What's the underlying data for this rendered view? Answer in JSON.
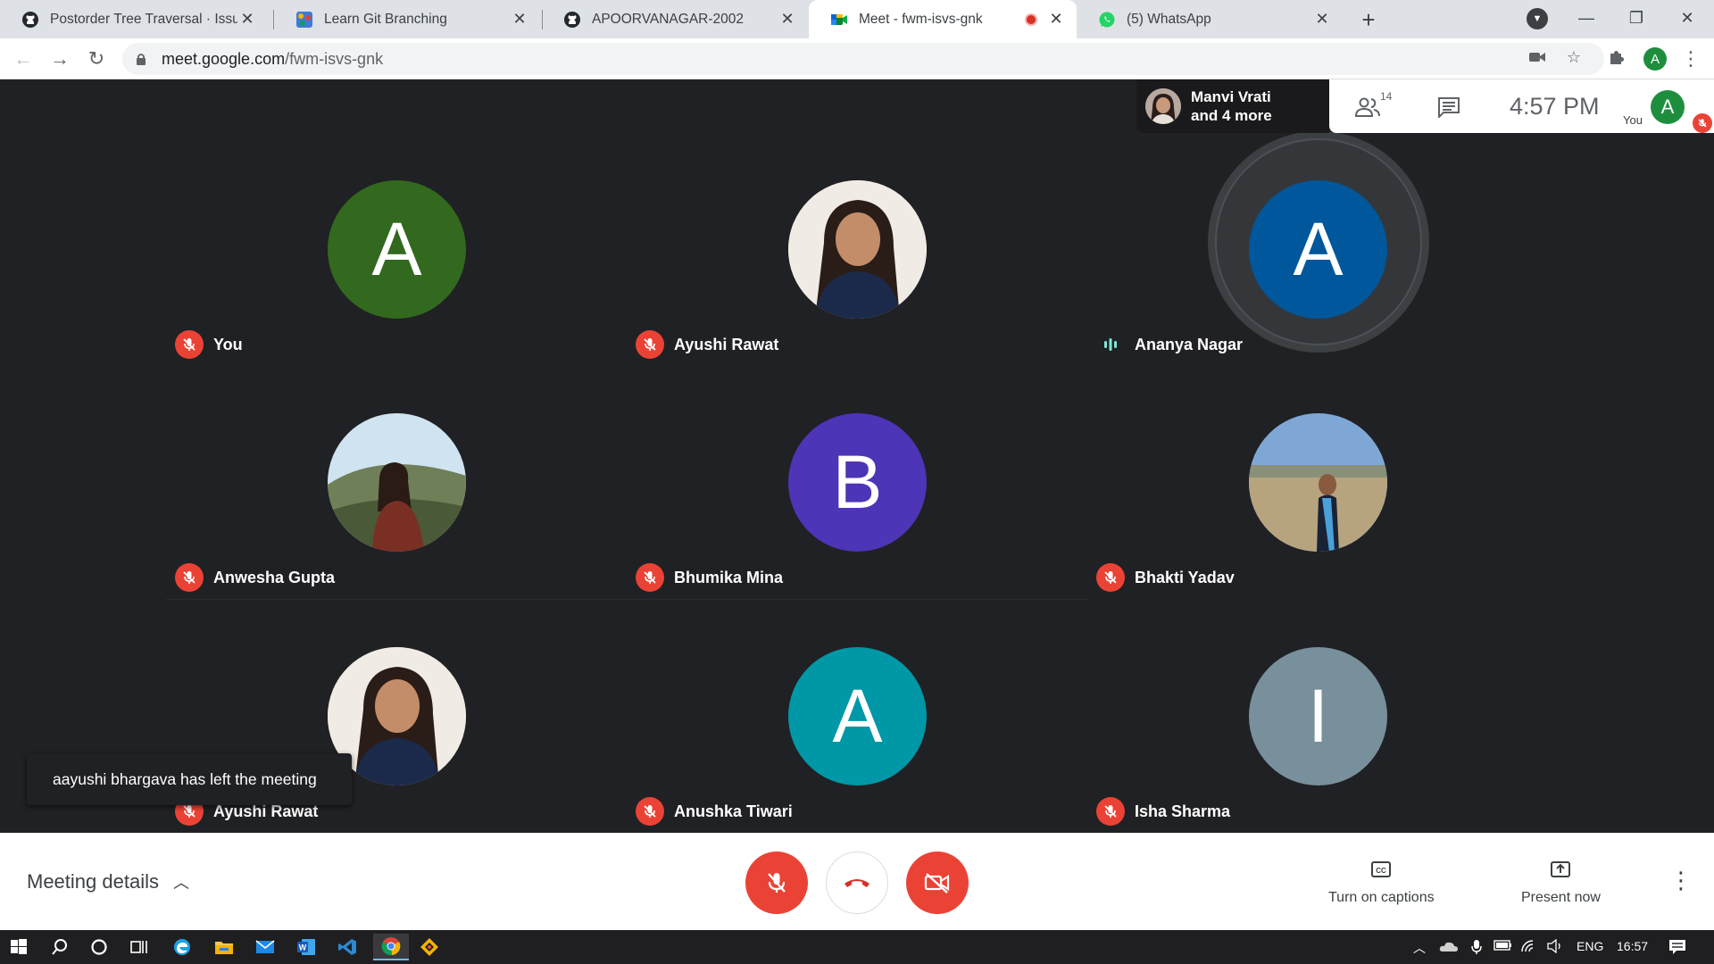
{
  "browser": {
    "tabs": [
      {
        "title": "Postorder Tree Traversal · Issue #",
        "icon": "github-icon",
        "active": false
      },
      {
        "title": "Learn Git Branching",
        "icon": "git-branching-icon",
        "active": false
      },
      {
        "title": "APOORVANAGAR-2002",
        "icon": "github-icon",
        "active": false
      },
      {
        "title": "Meet - fwm-isvs-gnk",
        "icon": "meet-icon",
        "active": true
      },
      {
        "title": "(5) WhatsApp",
        "icon": "whatsapp-icon",
        "active": false
      }
    ],
    "url_domain": "meet.google.com",
    "url_path": "/fwm-isvs-gnk",
    "profile_initial": "A"
  },
  "meet": {
    "presenter_line1": "Manvi Vrati",
    "presenter_line2": "and 4 more",
    "people_count": "14",
    "clock": "4:57  PM",
    "self_label": "You",
    "self_initial": "A",
    "participants": [
      {
        "name": "You",
        "initial": "A",
        "color": "#33691e",
        "mic": "muted"
      },
      {
        "name": "Ayushi Rawat",
        "initial": "",
        "color": "#1b2a4a",
        "mic": "muted"
      },
      {
        "name": "Ananya Nagar",
        "initial": "A",
        "color": "#01579b",
        "mic": "speaking"
      },
      {
        "name": "Anwesha Gupta",
        "initial": "",
        "color": "#7a8c6a",
        "mic": "muted"
      },
      {
        "name": "Bhumika Mina",
        "initial": "B",
        "color": "#4e34b6",
        "mic": "muted"
      },
      {
        "name": "Bhakti Yadav",
        "initial": "",
        "color": "#6f86a6",
        "mic": "muted"
      },
      {
        "name": "Ayushi Rawat",
        "initial": "",
        "color": "#1b2a4a",
        "mic": "muted"
      },
      {
        "name": "Anushka Tiwari",
        "initial": "A",
        "color": "#0097a7",
        "mic": "muted"
      },
      {
        "name": "Isha Sharma",
        "initial": "I",
        "color": "#78909c",
        "mic": "muted"
      }
    ],
    "toast": "aayushi bhargava has left the meeting"
  },
  "controls": {
    "meeting_details": "Meeting details",
    "captions_label": "Turn on captions",
    "present_label": "Present now"
  },
  "taskbar": {
    "language": "ENG",
    "time": "16:57"
  },
  "colors": {
    "accent_red": "#ea4335",
    "meet_bg": "#202124"
  }
}
